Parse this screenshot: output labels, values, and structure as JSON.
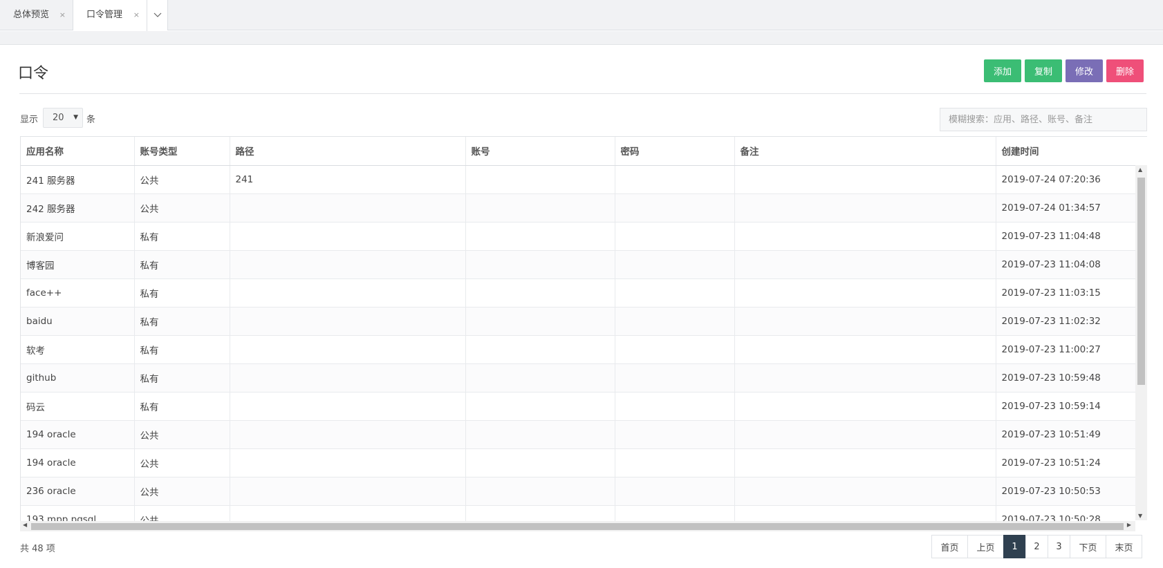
{
  "tabs": [
    {
      "label": "总体预览",
      "close": "×"
    },
    {
      "label": "口令管理",
      "close": "×"
    }
  ],
  "page": {
    "title": "口令"
  },
  "toolbar": {
    "add": "添加",
    "copy": "复制",
    "edit": "修改",
    "delete": "删除"
  },
  "toolbar_colors": {
    "add": "#3bbd74",
    "copy": "#3bbd74",
    "edit": "#7a6eb6",
    "delete": "#ef4f79"
  },
  "length_menu": {
    "prefix": "显示",
    "value": "20",
    "suffix": "条"
  },
  "search": {
    "placeholder": "模糊搜索：应用、路径、账号、备注"
  },
  "table": {
    "columns": [
      "应用名称",
      "账号类型",
      "路径",
      "账号",
      "密码",
      "备注",
      "创建时间"
    ],
    "rows": [
      [
        "241 服务器",
        "公共",
        "241",
        "",
        "",
        "",
        "2019-07-24 07:20:36"
      ],
      [
        "242 服务器",
        "公共",
        "",
        "",
        "",
        "",
        "2019-07-24 01:34:57"
      ],
      [
        "新浪爱问",
        "私有",
        "",
        "",
        "",
        "",
        "2019-07-23 11:04:48"
      ],
      [
        "博客园",
        "私有",
        "",
        "",
        "",
        "",
        "2019-07-23 11:04:08"
      ],
      [
        "face++",
        "私有",
        "",
        "",
        "",
        "",
        "2019-07-23 11:03:15"
      ],
      [
        "baidu",
        "私有",
        "",
        "",
        "",
        "",
        "2019-07-23 11:02:32"
      ],
      [
        "软考",
        "私有",
        "",
        "",
        "",
        "",
        "2019-07-23 11:00:27"
      ],
      [
        "github",
        "私有",
        "",
        "",
        "",
        "",
        "2019-07-23 10:59:48"
      ],
      [
        "码云",
        "私有",
        "",
        "",
        "",
        "",
        "2019-07-23 10:59:14"
      ],
      [
        "194 oracle",
        "公共",
        "",
        "",
        "",
        "",
        "2019-07-23 10:51:49"
      ],
      [
        "194 oracle",
        "公共",
        "",
        "",
        "",
        "",
        "2019-07-23 10:51:24"
      ],
      [
        "236 oracle",
        "公共",
        "",
        "",
        "",
        "",
        "2019-07-23 10:50:53"
      ],
      [
        "193 mpp pgsql",
        "公共",
        "",
        "",
        "",
        "",
        "2019-07-23 10:50:28"
      ]
    ]
  },
  "footer": {
    "total": "共 48 项",
    "pager": [
      "首页",
      "上页",
      "1",
      "2",
      "3",
      "下页",
      "末页"
    ],
    "active_page": "1"
  }
}
